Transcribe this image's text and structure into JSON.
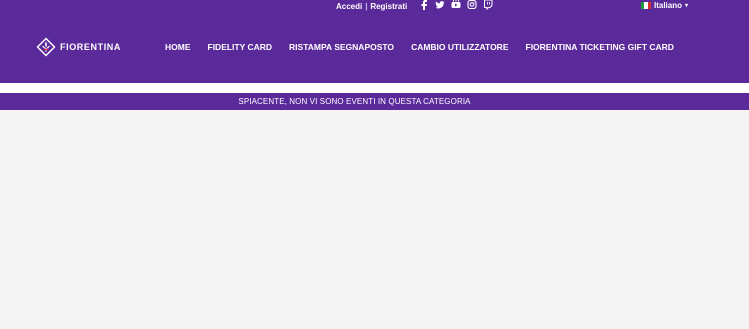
{
  "auth": {
    "login": "Accedi",
    "separator": "|",
    "register": "Registrati"
  },
  "social": [
    "facebook-icon",
    "twitter-icon",
    "youtube-icon",
    "instagram-icon",
    "twitch-icon"
  ],
  "language": {
    "selected": "Italiano"
  },
  "brand": {
    "name": "FIORENTINA"
  },
  "nav": {
    "items": [
      {
        "label": "HOME"
      },
      {
        "label": "FIDELITY CARD"
      },
      {
        "label": "RISTAMPA SEGNAPOSTO"
      },
      {
        "label": "CAMBIO UTILIZZATORE"
      },
      {
        "label": "FIORENTINA TICKETING GIFT CARD"
      }
    ]
  },
  "notice": {
    "text": "SPIACENTE, NON VI SONO EVENTI IN QUESTA CATEGORIA"
  },
  "colors": {
    "brand_purple": "#5b2a9a",
    "background": "#f4f4f4"
  }
}
